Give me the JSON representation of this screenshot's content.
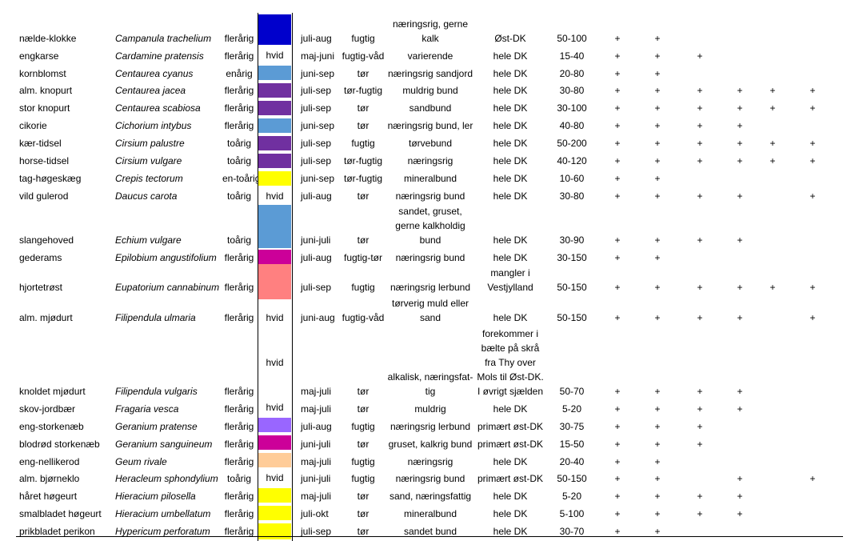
{
  "rows": [
    {
      "common": "nælde-klokke",
      "latin": "Campanula trachelium",
      "life": "flerårig",
      "color": "#0000cc",
      "colorLabel": "",
      "flower": "juli-aug",
      "moisture": "fugtig",
      "soil": "næringsrig, gerne kalk",
      "dist": "Øst-DK",
      "height": "50-100",
      "marks": [
        true,
        true,
        false,
        false,
        false,
        false
      ]
    },
    {
      "common": "engkarse",
      "latin": "Cardamine pratensis",
      "life": "flerårig",
      "color": "#ffffff",
      "colorLabel": "hvid",
      "flower": "maj-juni",
      "moisture": "fugtig-våd",
      "soil": "varierende",
      "dist": "hele DK",
      "height": "15-40",
      "marks": [
        true,
        true,
        true,
        false,
        false,
        false
      ]
    },
    {
      "common": "kornblomst",
      "latin": "Centaurea cyanus",
      "life": "enårig",
      "color": "#5b9bd5",
      "colorLabel": "",
      "flower": "juni-sep",
      "moisture": "tør",
      "soil": "næringsrig sandjord",
      "dist": "hele DK",
      "height": "20-80",
      "marks": [
        true,
        true,
        false,
        false,
        false,
        false
      ]
    },
    {
      "common": "alm. knopurt",
      "latin": "Centaurea jacea",
      "life": "flerårig",
      "color": "#7030a0",
      "colorLabel": "",
      "flower": "juli-sep",
      "moisture": "tør-fugtig",
      "soil": "muldrig bund",
      "dist": "hele DK",
      "height": "30-80",
      "marks": [
        true,
        true,
        true,
        true,
        true,
        true
      ]
    },
    {
      "common": "stor knopurt",
      "latin": "Centaurea scabiosa",
      "life": "flerårig",
      "color": "#7030a0",
      "colorLabel": "",
      "flower": "juli-sep",
      "moisture": "tør",
      "soil": "sandbund",
      "dist": "hele DK",
      "height": "30-100",
      "marks": [
        true,
        true,
        true,
        true,
        true,
        true
      ]
    },
    {
      "common": "cikorie",
      "latin": "Cichorium intybus",
      "life": "flerårig",
      "color": "#5b9bd5",
      "colorLabel": "",
      "flower": "juni-sep",
      "moisture": "tør",
      "soil": "næringsrig bund, ler",
      "dist": "hele DK",
      "height": "40-80",
      "marks": [
        true,
        true,
        true,
        true,
        false,
        false
      ]
    },
    {
      "common": "kær-tidsel",
      "latin": "Cirsium palustre",
      "life": "toårig",
      "color": "#7030a0",
      "colorLabel": "",
      "flower": "juli-sep",
      "moisture": "fugtig",
      "soil": "tørvebund",
      "dist": "hele DK",
      "height": "50-200",
      "marks": [
        true,
        true,
        true,
        true,
        true,
        true
      ]
    },
    {
      "common": "horse-tidsel",
      "latin": "Cirsium vulgare",
      "life": "toårig",
      "color": "#7030a0",
      "colorLabel": "",
      "flower": "juli-sep",
      "moisture": "tør-fugtig",
      "soil": "næringsrig",
      "dist": "hele DK",
      "height": "40-120",
      "marks": [
        true,
        true,
        true,
        true,
        true,
        true
      ]
    },
    {
      "common": "tag-høgeskæg",
      "latin": "Crepis tectorum",
      "life": "en-toårig",
      "color": "#ffff00",
      "colorLabel": "",
      "flower": "juni-sep",
      "moisture": "tør-fugtig",
      "soil": "mineralbund",
      "dist": "hele DK",
      "height": "10-60",
      "marks": [
        true,
        true,
        false,
        false,
        false,
        false
      ]
    },
    {
      "common": "vild gulerod",
      "latin": "Daucus carota",
      "life": "toårig",
      "color": "#ffffff",
      "colorLabel": "hvid",
      "flower": "juli-aug",
      "moisture": "tør",
      "soil": "næringsrig bund",
      "dist": "hele DK",
      "height": "30-80",
      "marks": [
        true,
        true,
        true,
        true,
        false,
        true
      ]
    },
    {
      "common": "slangehoved",
      "latin": "Echium vulgare",
      "life": "toårig",
      "color": "#5b9bd5",
      "colorLabel": "",
      "flower": "juni-juli",
      "moisture": "tør",
      "soil": "sandet, gruset, gerne kalkholdig bund",
      "dist": "hele DK",
      "height": "30-90",
      "marks": [
        true,
        true,
        true,
        true,
        false,
        false
      ]
    },
    {
      "common": "gederams",
      "latin": "Epilobium angustifolium",
      "life": "flerårig",
      "color": "#cc0099",
      "colorLabel": "",
      "flower": "juli-aug",
      "moisture": "fugtig-tør",
      "soil": "næringsrig bund",
      "dist": "hele DK",
      "height": "30-150",
      "marks": [
        true,
        true,
        false,
        false,
        false,
        false
      ]
    },
    {
      "common": "hjortetrøst",
      "latin": "Eupatorium cannabinum",
      "life": "flerårig",
      "color": "#ff8080",
      "colorLabel": "",
      "flower": "juli-sep",
      "moisture": "fugtig",
      "soil": "næringsrig lerbund",
      "dist": "mangler i Vestjylland",
      "height": "50-150",
      "marks": [
        true,
        true,
        true,
        true,
        true,
        true
      ]
    },
    {
      "common": "alm. mjødurt",
      "latin": "Filipendula ulmaria",
      "life": "flerårig",
      "color": "#ffffff",
      "colorLabel": "hvid",
      "flower": "juni-aug",
      "moisture": "fugtig-våd",
      "soil": "tørverig muld eller sand",
      "dist": "hele DK",
      "height": "50-150",
      "marks": [
        true,
        true,
        true,
        true,
        false,
        true
      ]
    },
    {
      "common": "knoldet mjødurt",
      "latin": "Filipendula vulgaris",
      "life": "flerårig",
      "color": "#ffffff",
      "colorLabel": "hvid",
      "flower": "maj-juli",
      "moisture": "tør",
      "soil": "alkalisk, næringsfat- tig",
      "dist": "forekommer i bælte på skrå fra Thy over Mols til Øst-DK. I øvrigt sjælden",
      "height": "50-70",
      "marks": [
        true,
        true,
        true,
        true,
        false,
        false
      ]
    },
    {
      "common": "skov-jordbær",
      "latin": "Fragaria vesca",
      "life": "flerårig",
      "color": "#ffffff",
      "colorLabel": "hvid",
      "flower": "maj-juli",
      "moisture": "tør",
      "soil": "muldrig",
      "dist": "hele DK",
      "height": "5-20",
      "marks": [
        true,
        true,
        true,
        true,
        false,
        false
      ]
    },
    {
      "common": "eng-storkenæb",
      "latin": "Geranium pratense",
      "life": "flerårig",
      "color": "#9966ff",
      "colorLabel": "",
      "flower": "juli-aug",
      "moisture": "fugtig",
      "soil": "næringsrig lerbund",
      "dist": "primært øst-DK",
      "height": "30-75",
      "marks": [
        true,
        true,
        true,
        false,
        false,
        false
      ]
    },
    {
      "common": "blodrød storkenæb",
      "latin": "Geranium sanguineum",
      "life": "flerårig",
      "color": "#cc0099",
      "colorLabel": "",
      "flower": "juni-juli",
      "moisture": "tør",
      "soil": "gruset, kalkrig bund",
      "dist": "primært øst-DK",
      "height": "15-50",
      "marks": [
        true,
        true,
        true,
        false,
        false,
        false
      ]
    },
    {
      "common": "eng-nellikerod",
      "latin": "Geum rivale",
      "life": "flerårig",
      "color": "#ffcc99",
      "colorLabel": "",
      "flower": "maj-juli",
      "moisture": "fugtig",
      "soil": "næringsrig",
      "dist": "hele DK",
      "height": "20-40",
      "marks": [
        true,
        true,
        false,
        false,
        false,
        false
      ]
    },
    {
      "common": "alm. bjørneklo",
      "latin": "Heracleum sphondylium",
      "life": "toårig",
      "color": "#ffffff",
      "colorLabel": "hvid",
      "flower": "juni-juli",
      "moisture": "fugtig",
      "soil": "næringsrig bund",
      "dist": "primært øst-DK",
      "height": "50-150",
      "marks": [
        true,
        true,
        false,
        true,
        false,
        true
      ]
    },
    {
      "common": "håret høgeurt",
      "latin": "Hieracium pilosella",
      "life": "flerårig",
      "color": "#ffff00",
      "colorLabel": "",
      "flower": "maj-juli",
      "moisture": "tør",
      "soil": "sand, næringsfattig",
      "dist": "hele DK",
      "height": "5-20",
      "marks": [
        true,
        true,
        true,
        true,
        false,
        false
      ]
    },
    {
      "common": "smalbladet høgeurt",
      "latin": "Hieracium umbellatum",
      "life": "flerårig",
      "color": "#ffff00",
      "colorLabel": "",
      "flower": "juli-okt",
      "moisture": "tør",
      "soil": "mineralbund",
      "dist": "hele DK",
      "height": "5-100",
      "marks": [
        true,
        true,
        true,
        true,
        false,
        false
      ]
    },
    {
      "common": "prikbladet perikon",
      "latin": "Hypericum perforatum",
      "life": "flerårig",
      "color": "#ffff00",
      "colorLabel": "",
      "flower": "juli-sep",
      "moisture": "tør",
      "soil": "sandet bund",
      "dist": "hele DK",
      "height": "30-70",
      "marks": [
        true,
        true,
        false,
        false,
        false,
        false
      ]
    }
  ],
  "markSymbol": "+"
}
